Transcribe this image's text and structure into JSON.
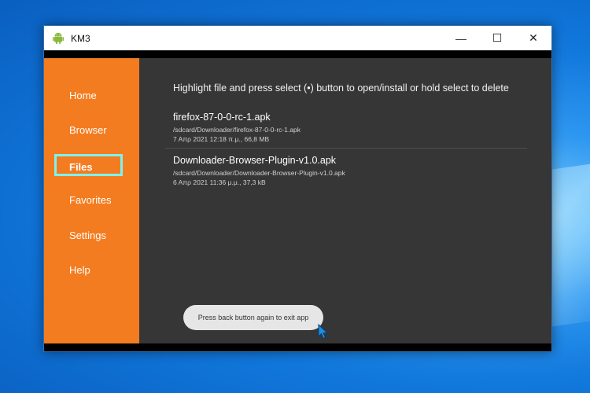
{
  "window": {
    "title": "KM3",
    "icon": "android-icon",
    "controls": {
      "minimize": "—",
      "maximize": "☐",
      "close": "✕"
    }
  },
  "sidebar": {
    "items": [
      {
        "label": "Home",
        "selected": false
      },
      {
        "label": "Browser",
        "selected": false
      },
      {
        "label": "Files",
        "selected": true
      },
      {
        "label": "Favorites",
        "selected": false
      },
      {
        "label": "Settings",
        "selected": false
      },
      {
        "label": "Help",
        "selected": false
      }
    ]
  },
  "main": {
    "instructions": "Highlight file and press select (•) button to open/install or hold select to delete",
    "files": [
      {
        "name": "firefox-87-0-0-rc-1.apk",
        "path": "/sdcard/Downloader/firefox-87-0-0-rc-1.apk",
        "meta": "7 Απρ 2021 12:18 π.μ., 66,8 MB"
      },
      {
        "name": "Downloader-Browser-Plugin-v1.0.apk",
        "path": "/sdcard/Downloader/Downloader-Browser-Plugin-v1.0.apk",
        "meta": "6 Απρ 2021 11:36 μ.μ., 37,3 kB"
      }
    ]
  },
  "toast": {
    "message": "Press back button again to exit app"
  },
  "colors": {
    "sidebar": "#f47c20",
    "content": "#363636",
    "selection": "#7ef2f0",
    "toast": "#e6e6e6"
  }
}
